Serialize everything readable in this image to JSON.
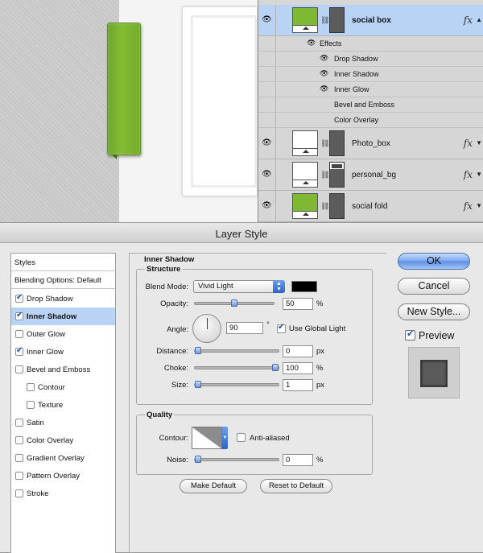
{
  "layers": {
    "social_box": {
      "name": "social box",
      "fx": "fx"
    },
    "effects_label": "Effects",
    "effects": [
      "Drop Shadow",
      "Inner Shadow",
      "Inner Glow",
      "Bevel and Emboss",
      "Color Overlay"
    ],
    "photo_box": {
      "name": "Photo_box",
      "fx": "fx"
    },
    "personal_bg": {
      "name": "personal_bg",
      "fx": "fx"
    },
    "social_fold": {
      "name": "social fold",
      "fx": "fx"
    }
  },
  "dialog": {
    "title": "Layer Style",
    "styles_header": "Styles",
    "blending_header": "Blending Options: Default",
    "style_items": [
      {
        "label": "Drop Shadow",
        "checked": true
      },
      {
        "label": "Inner Shadow",
        "checked": true,
        "selected": true
      },
      {
        "label": "Outer Glow",
        "checked": false
      },
      {
        "label": "Inner Glow",
        "checked": true
      },
      {
        "label": "Bevel and Emboss",
        "checked": false
      },
      {
        "label": "Contour",
        "checked": false
      },
      {
        "label": "Texture",
        "checked": false
      },
      {
        "label": "Satin",
        "checked": false
      },
      {
        "label": "Color Overlay",
        "checked": false
      },
      {
        "label": "Gradient Overlay",
        "checked": false
      },
      {
        "label": "Pattern Overlay",
        "checked": false
      },
      {
        "label": "Stroke",
        "checked": false
      }
    ],
    "section_title": "Inner Shadow",
    "structure": {
      "title": "Structure",
      "blend_mode_label": "Blend Mode:",
      "blend_mode_value": "Vivid Light",
      "shadow_color": "#000000",
      "opacity_label": "Opacity:",
      "opacity_value": "50",
      "opacity_unit": "%",
      "opacity_fraction": 0.5,
      "angle_label": "Angle:",
      "angle_value": "90",
      "angle_unit": "°",
      "global_light_label": "Use Global Light",
      "global_light_checked": true,
      "distance_label": "Distance:",
      "distance_value": "0",
      "distance_unit": "px",
      "distance_fraction": 0,
      "choke_label": "Choke:",
      "choke_value": "100",
      "choke_unit": "%",
      "choke_fraction": 1.0,
      "size_label": "Size:",
      "size_value": "1",
      "size_unit": "px",
      "size_fraction": 0.0
    },
    "quality": {
      "title": "Quality",
      "contour_label": "Contour:",
      "anti_aliased_label": "Anti-aliased",
      "anti_aliased_checked": false,
      "noise_label": "Noise:",
      "noise_value": "0",
      "noise_unit": "%",
      "noise_fraction": 0
    },
    "make_default": "Make Default",
    "reset_default": "Reset to Default",
    "ok": "OK",
    "cancel": "Cancel",
    "new_style": "New Style...",
    "preview_label": "Preview",
    "preview_checked": true
  },
  "colors": {
    "accent_green": "#7fb832",
    "selection_blue": "#b9d3f5",
    "dialog_bg": "#e8e8e8"
  }
}
